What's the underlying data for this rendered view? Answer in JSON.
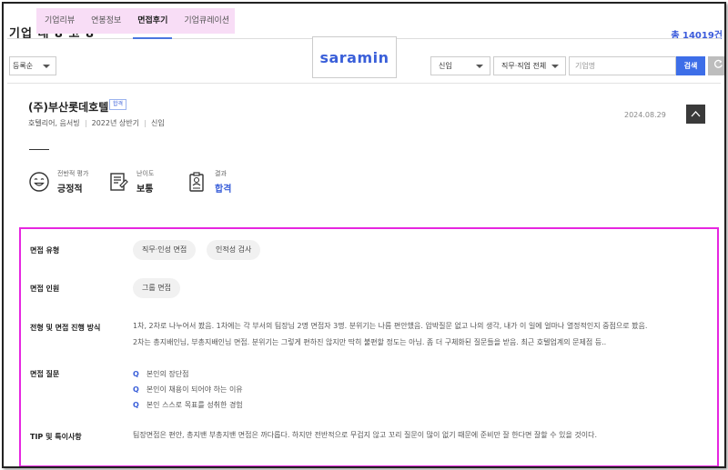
{
  "tabs": [
    {
      "label": "기업리뷰"
    },
    {
      "label": "연봉정보"
    },
    {
      "label": "면접후기"
    },
    {
      "label": "기업큐레이션"
    }
  ],
  "active_tab_index": 2,
  "background_heading": "기업 대 8 고 8",
  "background_count": "총 14019건",
  "logo_text": "saramin",
  "sort": {
    "selected": "등록순"
  },
  "filters": {
    "career": "신입",
    "job": "직무·직업 전체",
    "company_placeholder": "기업명",
    "search_label": "검색",
    "refresh_icon": "refresh-icon"
  },
  "review": {
    "company": "(주)부산롯데호텔",
    "badge": "합격",
    "meta": [
      "호텔리어, 음서빙",
      "2022년 상반기",
      "신입"
    ],
    "date": "2024.08.29",
    "summary": [
      {
        "label": "전반적 평가",
        "value": "긍정적",
        "icon": "smile-icon"
      },
      {
        "label": "난이도",
        "value": "보통",
        "icon": "document-icon"
      },
      {
        "label": "결과",
        "value": "합격",
        "icon": "badge-icon"
      }
    ],
    "details": {
      "type_label": "면접 유형",
      "type_chips": [
        "직무·인성 면접",
        "인적성 검사"
      ],
      "people_label": "면접 인원",
      "people_chips": [
        "그룹 면접"
      ],
      "process_label": "전형 및 면접 진행 방식",
      "process_lines": [
        "1차, 2차로 나누어서 봤음. 1차에는 각 부서의 팀장님 2명 면접자 3명. 분위기는 나름 편안했음. 압박질문 없고 나의 생각, 내가 이 일에 얼마나 열정적인지 중점으로 봤음.",
        "2차는 총지배인님, 부총지배인님 면접. 분위기는 그렇게 편하진 않지만 딱히 불편할 정도는 아님. 좀 더 구체화된 질문들을 받음. 최근 호텔업계의 문제점 등.."
      ],
      "questions_label": "면접 질문",
      "question_marker": "Q",
      "questions": [
        "본인의 장단점",
        "본인이 채용이 되어야 하는 이유",
        "본인 스스로 목표를 성취한 경험"
      ],
      "tip_label": "TIP 및 특이사항",
      "tip": "팀장면접은 편안, 총지밴 부총지밴 면접은 까다롭다. 하지만 전반적으로 무겁지 않고 꼬리 질문이 많이 없기 때문에 준비만 잘 한다면 잘할 수 있을 것이다."
    }
  },
  "colors": {
    "accent": "#3a5fd9",
    "highlight_box": "#e626e0",
    "tab_highlight": "#f8ddf6"
  }
}
